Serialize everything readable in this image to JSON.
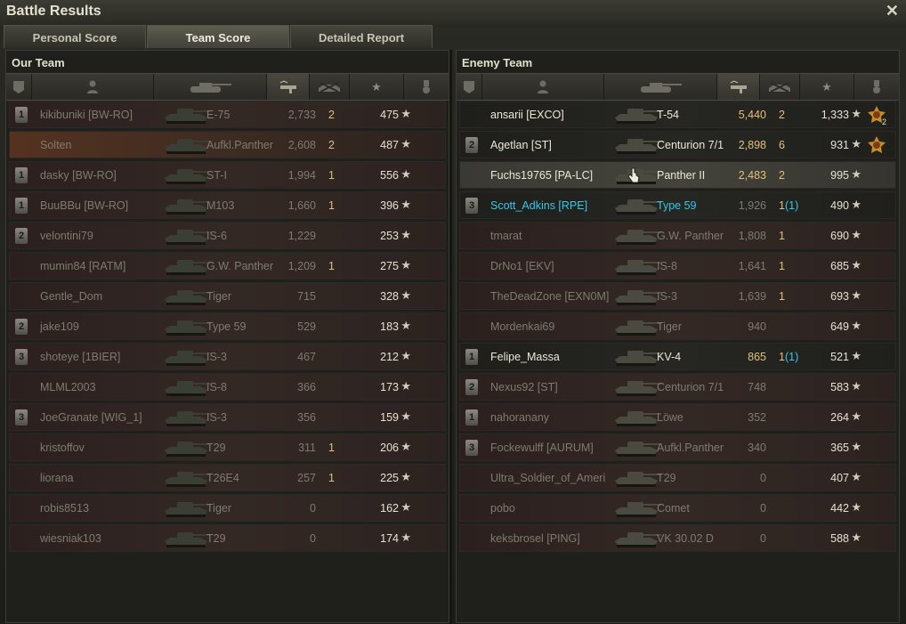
{
  "window": {
    "title": "Battle Results"
  },
  "tabs": [
    {
      "label": "Personal Score"
    },
    {
      "label": "Team Score"
    },
    {
      "label": "Detailed Report"
    }
  ],
  "our_team": {
    "title": "Our Team",
    "rows": [
      {
        "badge": "1",
        "name": "kikibuniki [BW-RO]",
        "tank": "E-75",
        "damage": "2,733",
        "kills": "2",
        "xp": "475"
      },
      {
        "badge": "",
        "name": "Solten",
        "tank": "Aufkl.Panther",
        "damage": "2,608",
        "kills": "2",
        "xp": "487"
      },
      {
        "badge": "1",
        "name": "dasky [BW-RO]",
        "tank": "ST-I",
        "damage": "1,994",
        "kills": "1",
        "xp": "556"
      },
      {
        "badge": "1",
        "name": "BuuBBu [BW-RO]",
        "tank": "M103",
        "damage": "1,660",
        "kills": "1",
        "xp": "396"
      },
      {
        "badge": "2",
        "name": "velontini79",
        "tank": "IS-6",
        "damage": "1,229",
        "kills": "",
        "xp": "253"
      },
      {
        "badge": "",
        "name": "mumin84 [RATM]",
        "tank": "G.W. Panther",
        "damage": "1,209",
        "kills": "1",
        "xp": "275"
      },
      {
        "badge": "",
        "name": "Gentle_Dom",
        "tank": "Tiger",
        "damage": "715",
        "kills": "",
        "xp": "328"
      },
      {
        "badge": "2",
        "name": "jake109",
        "tank": "Type 59",
        "damage": "529",
        "kills": "",
        "xp": "183"
      },
      {
        "badge": "3",
        "name": "shoteye [1BIER]",
        "tank": "IS-3",
        "damage": "467",
        "kills": "",
        "xp": "212"
      },
      {
        "badge": "",
        "name": "MLML2003",
        "tank": "IS-8",
        "damage": "366",
        "kills": "",
        "xp": "173"
      },
      {
        "badge": "3",
        "name": "JoeGranate [WIG_1]",
        "tank": "IS-3",
        "damage": "356",
        "kills": "",
        "xp": "159"
      },
      {
        "badge": "",
        "name": "kristoffov",
        "tank": "T29",
        "damage": "311",
        "kills": "1",
        "xp": "206"
      },
      {
        "badge": "",
        "name": "liorana",
        "tank": "T26E4",
        "damage": "257",
        "kills": "1",
        "xp": "225"
      },
      {
        "badge": "",
        "name": "robis8513",
        "tank": "Tiger",
        "damage": "0",
        "kills": "",
        "xp": "162"
      },
      {
        "badge": "",
        "name": "wiesniak103",
        "tank": "T29",
        "damage": "0",
        "kills": "",
        "xp": "174"
      }
    ]
  },
  "enemy_team": {
    "title": "Enemy Team",
    "rows": [
      {
        "badge": "",
        "name": "ansarii [EXCO]",
        "tank": "T-54",
        "damage": "5,440",
        "kills": "2",
        "xp": "1,333"
      },
      {
        "badge": "2",
        "name": "Agetlan [ST]",
        "tank": "Centurion 7/1",
        "damage": "2,898",
        "kills": "6",
        "xp": "931"
      },
      {
        "badge": "",
        "name": "Fuchs19765 [PA-LC]",
        "tank": "Panther II",
        "damage": "2,483",
        "kills": "2",
        "xp": "995"
      },
      {
        "badge": "3",
        "name": "Scott_Adkins [RPE]",
        "tank": "Type 59",
        "damage": "1,926",
        "kills": "1",
        "kills_extra": "(1)",
        "xp": "490"
      },
      {
        "badge": "",
        "name": "tmarat",
        "tank": "G.W. Panther",
        "damage": "1,808",
        "kills": "1",
        "xp": "690"
      },
      {
        "badge": "",
        "name": "DrNo1 [EKV]",
        "tank": "IS-8",
        "damage": "1,641",
        "kills": "1",
        "xp": "685"
      },
      {
        "badge": "",
        "name": "TheDeadZone [EXN0M]",
        "tank": "IS-3",
        "damage": "1,639",
        "kills": "1",
        "xp": "693"
      },
      {
        "badge": "",
        "name": "Mordenkai69",
        "tank": "Tiger",
        "damage": "940",
        "kills": "",
        "xp": "649"
      },
      {
        "badge": "1",
        "name": "Felipe_Massa",
        "tank": "KV-4",
        "damage": "865",
        "kills": "1",
        "kills_extra": "(1)",
        "xp": "521"
      },
      {
        "badge": "2",
        "name": "Nexus92 [ST]",
        "tank": "Centurion 7/1",
        "damage": "748",
        "kills": "",
        "xp": "583"
      },
      {
        "badge": "1",
        "name": "nahoranany",
        "tank": "Löwe",
        "damage": "352",
        "kills": "",
        "xp": "264"
      },
      {
        "badge": "3",
        "name": "Fockewulff [AURUM]",
        "tank": "Aufkl.Panther",
        "damage": "340",
        "kills": "",
        "xp": "365"
      },
      {
        "badge": "",
        "name": "Ultra_Soldier_of_Ameri",
        "tank": "T29",
        "damage": "0",
        "kills": "",
        "xp": "407"
      },
      {
        "badge": "",
        "name": "pobo",
        "tank": "Comet",
        "damage": "0",
        "kills": "",
        "xp": "442"
      },
      {
        "badge": "",
        "name": "keksbrosel [PING]",
        "tank": "VK 30.02 D",
        "damage": "0",
        "kills": "",
        "xp": "588"
      }
    ]
  },
  "medal_count": "2",
  "colors": {
    "highlight_cyan": "#36c8e8",
    "gold": "#e2c07a",
    "player_row": "#55321f"
  }
}
